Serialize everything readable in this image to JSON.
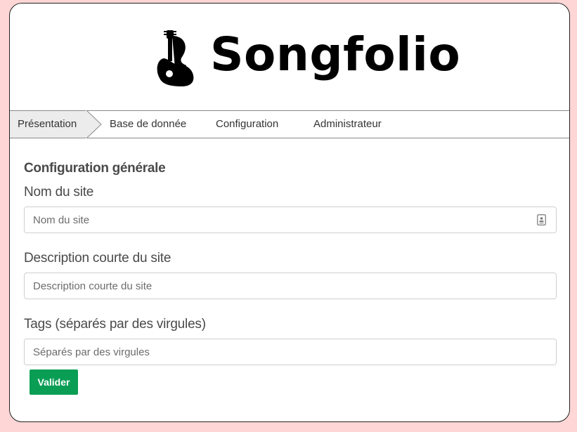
{
  "brand": {
    "name": "Songfolio",
    "logo_icon": "guitar-player-icon"
  },
  "stepper": {
    "steps": [
      {
        "label": "Présentation",
        "active": true
      },
      {
        "label": "Base de donnée",
        "active": false
      },
      {
        "label": "Configuration",
        "active": false
      },
      {
        "label": "Administrateur",
        "active": false
      }
    ]
  },
  "form": {
    "section_title": "Configuration générale",
    "fields": [
      {
        "label": "Nom du site",
        "value": "",
        "placeholder": "Nom du site",
        "icon": "contact-card-icon"
      },
      {
        "label": "Description courte du site",
        "value": "",
        "placeholder": "Description courte du site"
      },
      {
        "label": "Tags (séparés par des virgules)",
        "value": "",
        "placeholder": "Séparés par des virgules"
      }
    ],
    "submit_label": "Valider"
  },
  "colors": {
    "page_background": "#ffd6d6",
    "submit_button": "#0a9e55",
    "active_step": "#ececec"
  }
}
